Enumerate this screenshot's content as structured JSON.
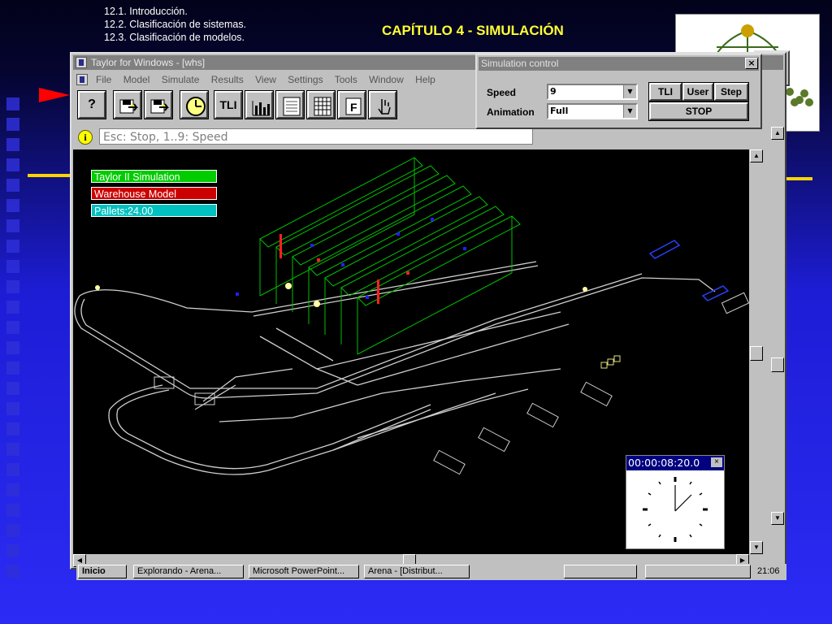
{
  "slide": {
    "lines": [
      "12.1. Introducción.",
      "12.2. Clasificación de sistemas.",
      "12.3. Clasificación de modelos."
    ],
    "title": "CAPÍTULO 4 - SIMULACIÓN"
  },
  "main_window": {
    "title": "Taylor for Windows - [whs]",
    "menu": [
      "File",
      "Model",
      "Simulate",
      "Results",
      "View",
      "Settings",
      "Tools",
      "Window",
      "Help"
    ],
    "toolbar": [
      {
        "label": "?",
        "icon": "help-icon"
      },
      {
        "label": "",
        "icon": "open-model-icon"
      },
      {
        "label": "",
        "icon": "save-model-icon"
      },
      {
        "label": "",
        "icon": "clock-icon"
      },
      {
        "label": "TLI",
        "icon": "tli-icon"
      },
      {
        "label": "",
        "icon": "bar-chart-icon"
      },
      {
        "label": "",
        "icon": "report-icon"
      },
      {
        "label": "",
        "icon": "table-icon"
      },
      {
        "label": "F",
        "icon": "f-icon"
      },
      {
        "label": "",
        "icon": "hand-icon"
      }
    ],
    "status_text": "Esc: Stop, 1..9: Speed"
  },
  "viewport": {
    "labels": [
      {
        "text": "Taylor II Simulation",
        "color": "#00cc00"
      },
      {
        "text": "Warehouse Model",
        "color": "#cc0000"
      },
      {
        "text": "Pallets:24.00",
        "color": "#00c0c0"
      }
    ],
    "clock": {
      "time": "00:00:08:20.0"
    }
  },
  "sim_control": {
    "title": "Simulation control",
    "speed_label": "Speed",
    "speed_value": "9",
    "animation_label": "Animation",
    "animation_value": "Full",
    "buttons": {
      "tli": "TLI",
      "user": "User",
      "step": "Step",
      "stop": "STOP"
    }
  },
  "taskbar": {
    "items": [
      "Inicio",
      "Explorando - Arena...",
      "Microsoft PowerPoint...",
      "Arena - [Distribut...",
      "",
      "",
      "21:06"
    ]
  }
}
